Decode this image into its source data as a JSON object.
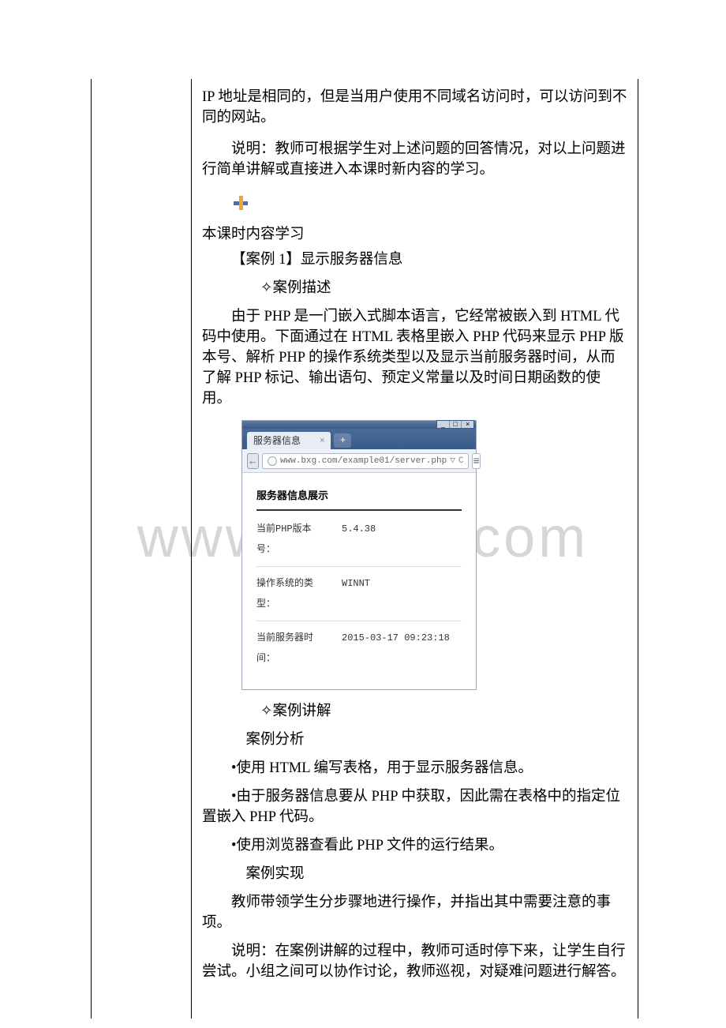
{
  "intro": {
    "p1": "IP 地址是相同的，但是当用户使用不同域名访问时，可以访问到不同的网站。",
    "p2": "说明：教师可根据学生对上述问题的回答情况，对以上问题进行简单讲解或直接进入本课时新内容的学习。"
  },
  "section": {
    "heading": "本课时内容学习",
    "case_label": "【案例 1】显示服务器信息",
    "sub_desc_label": "案例描述",
    "desc": "由于 PHP 是一门嵌入式脚本语言，它经常被嵌入到 HTML 代码中使用。下面通过在 HTML 表格里嵌入 PHP 代码来显示 PHP 版本号、解析 PHP 的操作系统类型以及显示当前服务器时间，从而了解 PHP 标记、输出语句、预定义常量以及时间日期函数的使用。"
  },
  "browser": {
    "window_controls": {
      "min": "_",
      "max": "□",
      "close": "×"
    },
    "tab_title": "服务器信息",
    "tab_close": "×",
    "newtab": "+",
    "back": "←",
    "url": "www.bxg.com/example01/server.php",
    "url_tail": {
      "dropdown": "▽",
      "reload": "C"
    },
    "menu": "≡",
    "page": {
      "heading": "服务器信息展示",
      "rows": [
        {
          "label": "当前PHP版本号：",
          "value": "5.4.38"
        },
        {
          "label": "操作系统的类型：",
          "value": "WINNT"
        },
        {
          "label": "当前服务器时间：",
          "value": "2015-03-17 09:23:18"
        }
      ]
    }
  },
  "explain": {
    "sub_explain_label": "案例讲解",
    "sub_analysis_label": "案例分析",
    "bullets": [
      "•使用 HTML 编写表格，用于显示服务器信息。",
      "•由于服务器信息要从 PHP 中获取，因此需在表格中的指定位置嵌入 PHP 代码。",
      "•使用浏览器查看此 PHP 文件的运行结果。"
    ],
    "sub_impl_label": "案例实现",
    "impl_p1": "教师带领学生分步骤地进行操作，并指出其中需要注意的事项。",
    "impl_p2": "说明：在案例讲解的过程中，教师可适时停下来，让学生自行尝试。小组之间可以协作讨论，教师巡视，对疑难问题进行解答。"
  },
  "watermark": "www.bdocx.com",
  "glyphs": {
    "diamond": "✧",
    "square": ""
  }
}
